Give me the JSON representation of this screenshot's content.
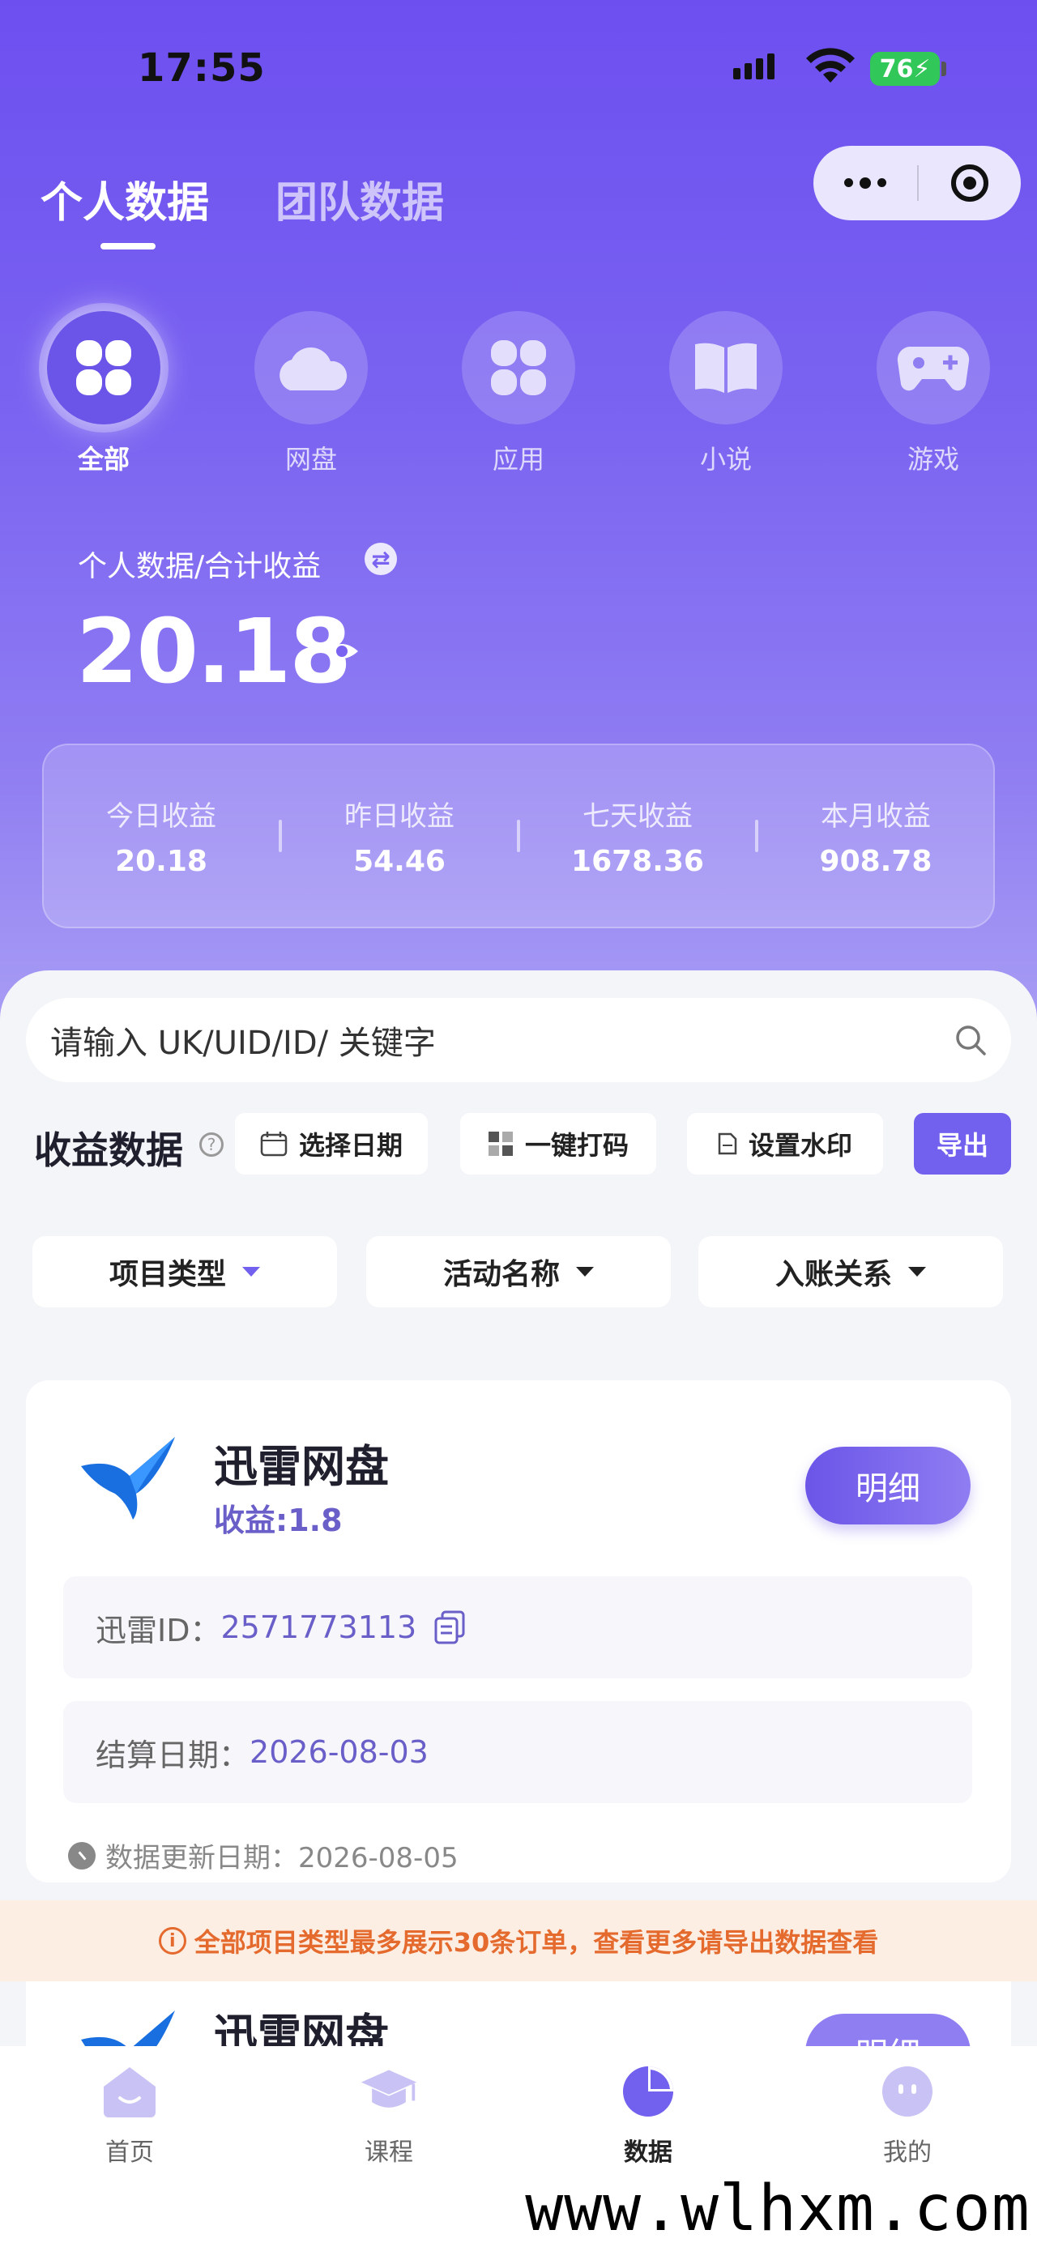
{
  "status_bar": {
    "time": "17:55",
    "battery": "76"
  },
  "tabs": [
    {
      "label": "个人数据",
      "active": true
    },
    {
      "label": "团队数据",
      "active": false
    }
  ],
  "categories": [
    {
      "label": "全部",
      "icon": "clover-icon",
      "active": true
    },
    {
      "label": "网盘",
      "icon": "cloud-icon",
      "active": false
    },
    {
      "label": "应用",
      "icon": "apps-icon",
      "active": false
    },
    {
      "label": "小说",
      "icon": "book-icon",
      "active": false
    },
    {
      "label": "游戏",
      "icon": "gamepad-icon",
      "active": false
    }
  ],
  "summary": {
    "title": "个人数据/合计收益",
    "total": "20.18"
  },
  "stats": [
    {
      "label": "今日收益",
      "value": "20.18"
    },
    {
      "label": "昨日收益",
      "value": "54.46"
    },
    {
      "label": "七天收益",
      "value": "1678.36"
    },
    {
      "label": "本月收益",
      "value": "908.78"
    }
  ],
  "search": {
    "placeholder": "请输入 UK/UID/ID/ 关键字"
  },
  "toolbar": {
    "title": "收益数据",
    "select_date": "选择日期",
    "one_click_code": "一键打码",
    "watermark": "设置水印",
    "export": "导出"
  },
  "filters": [
    {
      "label": "项目类型"
    },
    {
      "label": "活动名称"
    },
    {
      "label": "入账关系"
    }
  ],
  "card": {
    "title": "迅雷网盘",
    "earnings": "收益:1.8",
    "detail": "明细",
    "id_label": "迅雷ID：",
    "id_value": "2571773113",
    "settle_label": "结算日期：",
    "settle_value": "2026-08-03",
    "update_text": "数据更新日期：2026-08-05"
  },
  "notice": "全部项目类型最多展示30条订单，查看更多请导出数据查看",
  "card2": {
    "title": "迅雷网盘",
    "detail": "明细"
  },
  "tabbar": [
    {
      "label": "首页"
    },
    {
      "label": "课程"
    },
    {
      "label": "数据",
      "active": true
    },
    {
      "label": "我的"
    }
  ],
  "watermark": "www.wlhxm.com",
  "colors": {
    "primary": "#6d4ff0",
    "accent": "#7260ee",
    "notice": "#e46a2d"
  }
}
